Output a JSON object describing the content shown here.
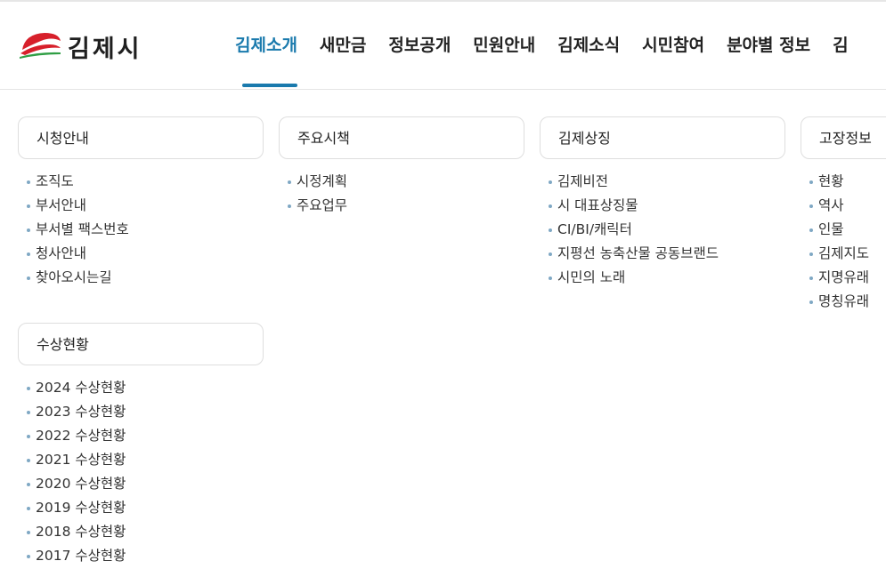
{
  "header": {
    "logo_text": "김제시",
    "nav": [
      {
        "label": "김제소개",
        "active": true
      },
      {
        "label": "새만금"
      },
      {
        "label": "정보공개"
      },
      {
        "label": "민원안내"
      },
      {
        "label": "김제소식"
      },
      {
        "label": "시민참여"
      },
      {
        "label": "분야별 정보"
      },
      {
        "label": "김"
      }
    ]
  },
  "menu": {
    "sections": [
      {
        "title": "시청안내",
        "items": [
          "조직도",
          "부서안내",
          "부서별 팩스번호",
          "청사안내",
          "찾아오시는길"
        ]
      },
      {
        "title": "주요시책",
        "items": [
          "시정계획",
          "주요업무"
        ]
      },
      {
        "title": "김제상징",
        "items": [
          "김제비전",
          "시 대표상징물",
          "CI/BI/캐릭터",
          "지평선 농축산물 공동브랜드",
          "시민의 노래"
        ]
      },
      {
        "title": "고장정보",
        "items": [
          "현황",
          "역사",
          "인물",
          "김제지도",
          "지명유래",
          "명칭유래"
        ]
      },
      {
        "title": "수상현황",
        "items": [
          "2024 수상현황",
          "2023 수상현황",
          "2022 수상현황",
          "2021 수상현황",
          "2020 수상현황",
          "2019 수상현황",
          "2018 수상현황",
          "2017 수상현황"
        ]
      }
    ]
  },
  "colors": {
    "accent": "#1a7aad",
    "logo_red": "#d7202b",
    "logo_green": "#2f9e44",
    "bullet": "#7fa8c4"
  }
}
